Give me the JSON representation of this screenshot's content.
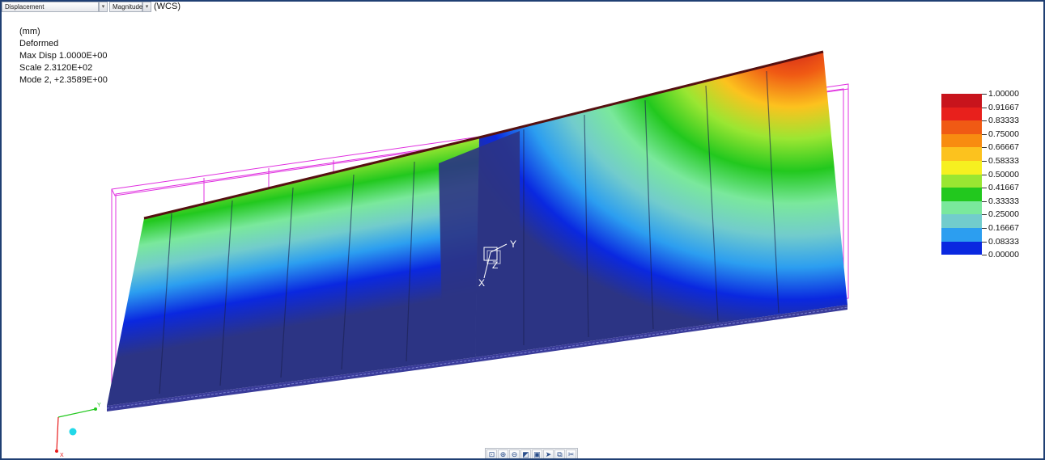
{
  "controls": {
    "result_type": "Displacement",
    "component": "Magnitude",
    "coordinate_system": "(WCS)"
  },
  "info": {
    "units": "(mm)",
    "state": "Deformed",
    "max_disp": "Max Disp  1.0000E+00",
    "scale": "Scale  2.3120E+02",
    "mode": "Mode 2,  +2.3589E+00"
  },
  "legend": {
    "labels": [
      "1.00000",
      "0.91667",
      "0.83333",
      "0.75000",
      "0.66667",
      "0.58333",
      "0.50000",
      "0.41667",
      "0.33333",
      "0.25000",
      "0.16667",
      "0.08333",
      "0.00000"
    ],
    "colors": [
      "#c8141c",
      "#e8201c",
      "#f05a14",
      "#f88c10",
      "#fcc21e",
      "#f6f020",
      "#9ae632",
      "#22c81e",
      "#7ae89c",
      "#72cccc",
      "#2c9ef0",
      "#0a28e0",
      "#2c3484"
    ]
  },
  "triad": {
    "y": "Y",
    "x": "X",
    "z": "Z"
  },
  "axes": {
    "y": "Y",
    "x": "X"
  },
  "toolbar": {
    "icons": [
      "zoom-fit-icon",
      "zoom-in-icon",
      "zoom-out-icon",
      "shade-icon",
      "view-icon",
      "pan-icon",
      "select-icon",
      "query-icon"
    ]
  }
}
